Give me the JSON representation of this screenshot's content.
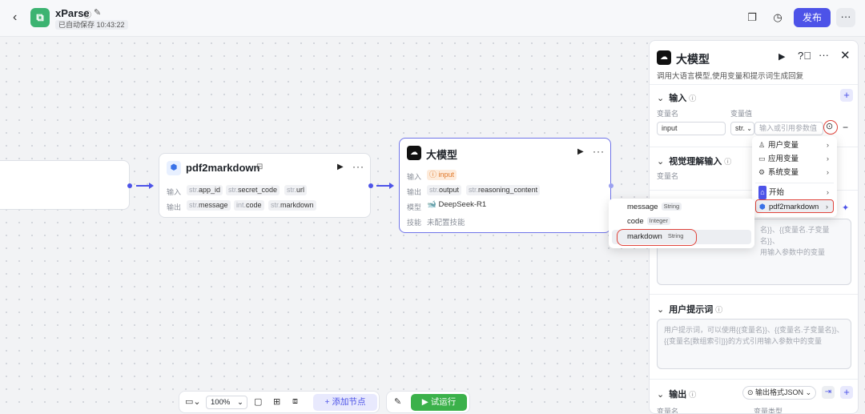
{
  "header": {
    "app_name": "xParse",
    "save_status": "已自动保存 10:43:22",
    "publish_label": "发布",
    "more_label": "···"
  },
  "nodes": {
    "pdf2markdown": {
      "title": "pdf2markdown",
      "input_label": "输入",
      "output_label": "输出",
      "inputs": [
        {
          "type": "str.",
          "name": "app_id"
        },
        {
          "type": "str.",
          "name": "secret_code"
        },
        {
          "type": "str.",
          "name": "url"
        }
      ],
      "outputs": [
        {
          "type": "str.",
          "name": "message"
        },
        {
          "type": "int.",
          "name": "code"
        },
        {
          "type": "str.",
          "name": "markdown"
        }
      ]
    },
    "llm": {
      "title": "大模型",
      "input_label": "输入",
      "output_label": "输出",
      "model_label": "模型",
      "skill_label": "技能",
      "input_var": "input",
      "outputs": [
        {
          "type": "str.",
          "name": "output"
        },
        {
          "type": "str.",
          "name": "reasoning_content"
        }
      ],
      "model_name": "DeepSeek-R1",
      "skill_value": "未配置技能"
    }
  },
  "panel": {
    "title": "大模型",
    "description": "调用大语言模型,使用变量和提示词生成回复",
    "input_section": {
      "title": "输入",
      "col_name": "变量名",
      "col_value": "变量值",
      "var_name": "input",
      "type_value": "str.",
      "value_placeholder": "输入或引用参数值"
    },
    "vision_section": {
      "title": "视觉理解输入",
      "col_name": "变量名"
    },
    "system_prompt_fragments": [
      "名}}、{{变量名.子变量名}}、",
      "用输入参数中的变量"
    ],
    "user_prompt": {
      "title": "用户提示词",
      "placeholder": "用户提示词，可以使用{{变量名}}、{{变量名.子变量名}}、{{变量名[数组索引]}}的方式引用输入参数中的变量"
    },
    "output_section": {
      "title": "输出",
      "format_label": "输出格式JSON",
      "col_name": "变量名",
      "col_type": "变量类型"
    }
  },
  "ref_menu": {
    "items": [
      {
        "label": "用户变量",
        "icon": "person-icon"
      },
      {
        "label": "应用变量",
        "icon": "folder-icon"
      },
      {
        "label": "系统变量",
        "icon": "gear-icon"
      },
      {
        "label": "开始",
        "icon": "start-icon"
      },
      {
        "label": "pdf2markdown",
        "icon": "plugin-icon"
      }
    ]
  },
  "sub_menu": {
    "items": [
      {
        "label": "message",
        "type": "String"
      },
      {
        "label": "code",
        "type": "Integer"
      },
      {
        "label": "markdown",
        "type": "String"
      }
    ]
  },
  "toolbar": {
    "zoom": "100%",
    "add_node_label": "添加节点",
    "run_label": "试运行"
  },
  "colors": {
    "accent": "#4d53e8",
    "run_green": "#3bb14a",
    "highlight_red": "#e0433a",
    "app_logo": "#3cb371"
  }
}
